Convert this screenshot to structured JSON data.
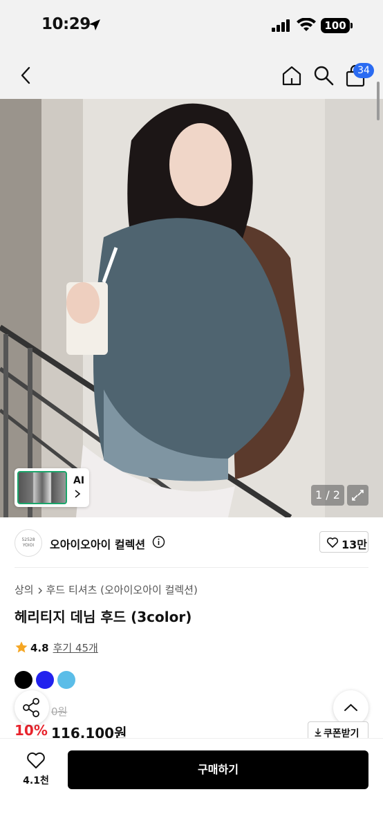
{
  "status_bar": {
    "time": "10:29",
    "battery": "100"
  },
  "nav": {
    "cart_count": "34"
  },
  "gallery": {
    "ai_label": "AI",
    "page_indicator": "1 / 2"
  },
  "brand": {
    "logo_line1": "52528",
    "logo_line2": "YOIOI",
    "name": "오아이오아이 컬렉션",
    "likes": "13만"
  },
  "product": {
    "breadcrumb": [
      "상의",
      "후드 티셔츠 (오아이오아이 컬렉션)"
    ],
    "title": "헤리티지 데님 후드 (3color)",
    "rating": "4.8",
    "review_label": "후기 45개",
    "colors": [
      "#000000",
      "#2222ee",
      "#5bbde8"
    ],
    "original_price": "0원",
    "discount": "10%",
    "price": "116,100원",
    "coupon_label": "쿠폰받기"
  },
  "bottom_bar": {
    "wish_count": "4.1천",
    "buy_label": "구매하기"
  },
  "colors": {
    "accent_blue": "#2a6bf2",
    "discount_red": "#e8242d",
    "star": "#f5a623"
  }
}
